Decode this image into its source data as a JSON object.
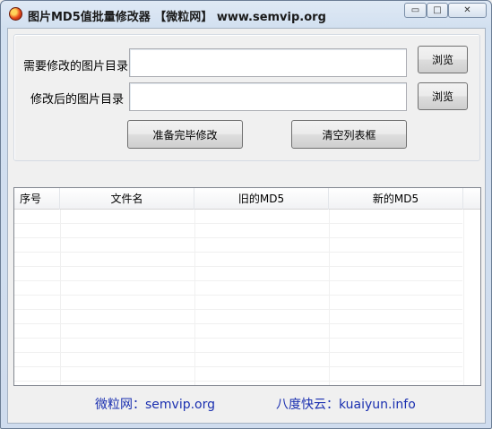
{
  "window": {
    "title": "图片MD5值批量修改器 【微粒网】 www.semvip.org",
    "controls": {
      "minimize": "▭",
      "maximize": "□",
      "close": "✕"
    }
  },
  "form": {
    "source_dir_label": "需要修改的图片目录",
    "source_dir_value": "",
    "target_dir_label": "修改后的图片目录",
    "target_dir_value": "",
    "browse_label_1": "浏览",
    "browse_label_2": "浏览",
    "ready_button": "准备完毕修改",
    "clear_button": "清空列表框"
  },
  "list": {
    "columns": [
      "序号",
      "文件名",
      "旧的MD5",
      "新的MD5"
    ],
    "rows": []
  },
  "footer": {
    "link_1": "微粒网：semvip.org",
    "link_2": "八度快云：kuaiyun.info"
  }
}
